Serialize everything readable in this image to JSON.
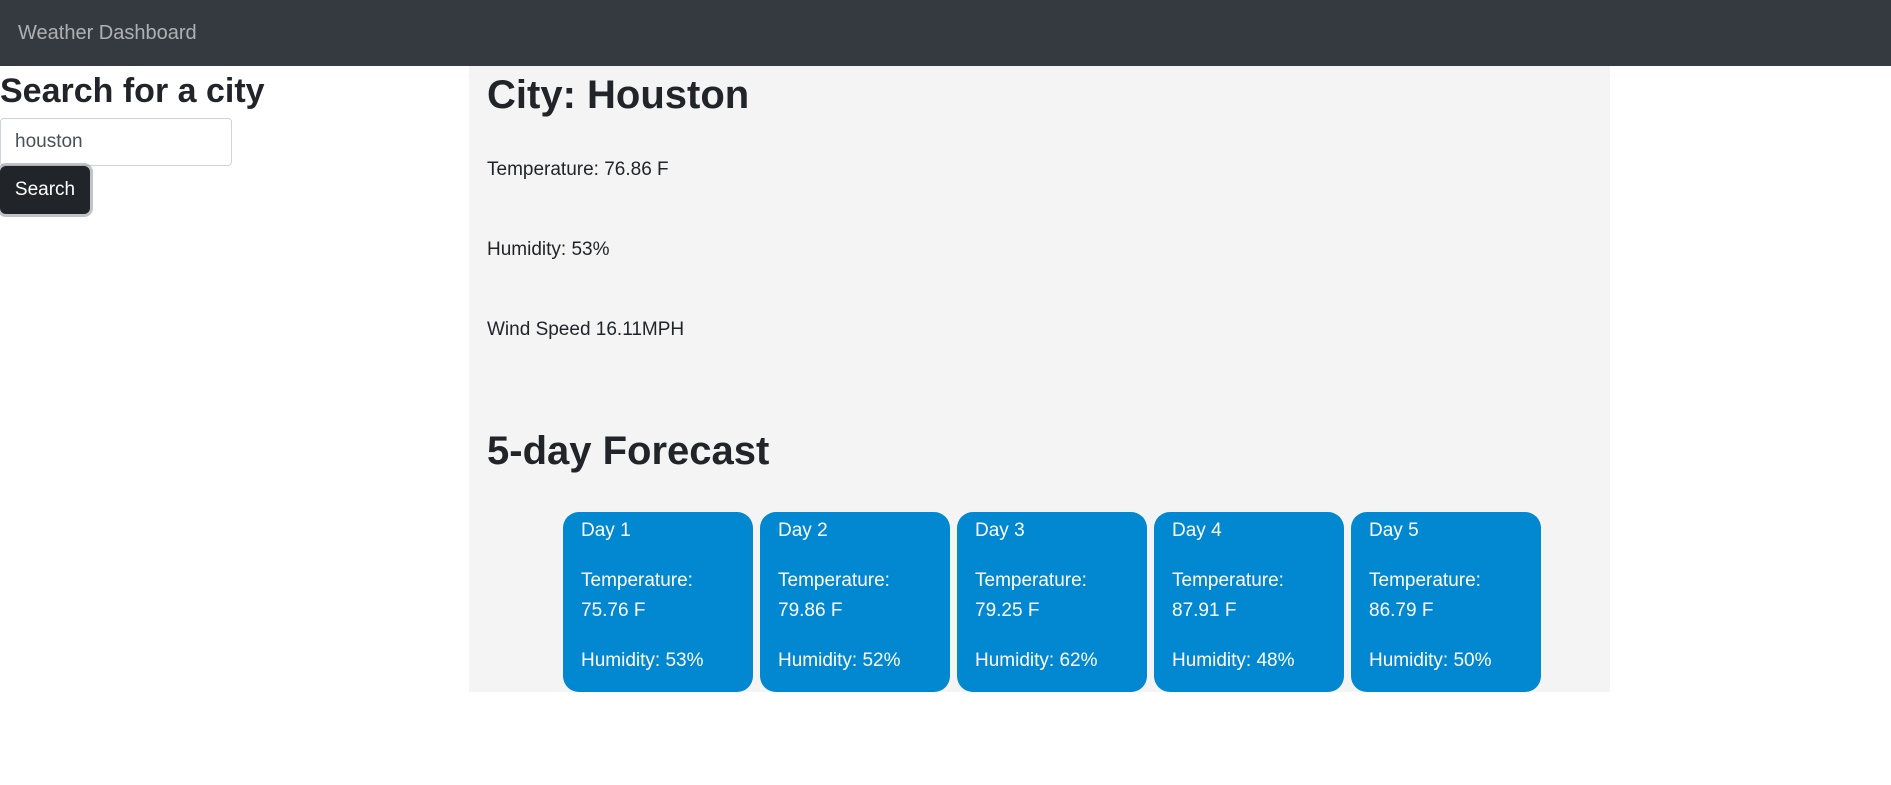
{
  "navbar": {
    "brand": "Weather Dashboard"
  },
  "search": {
    "title": "Search for a city",
    "input_value": "houston",
    "button_label": "Search"
  },
  "current": {
    "city": "City: Houston",
    "temperature": "Temperature: 76.86 F",
    "humidity": "Humidity: 53%",
    "wind": "Wind Speed 16.11MPH"
  },
  "forecast": {
    "title": "5-day Forecast",
    "card_color": "#0288d1",
    "days": [
      {
        "day": "Day 1",
        "temp_label": "Temperature:",
        "temp_value": "75.76 F",
        "humidity": "Humidity: 53%"
      },
      {
        "day": "Day 2",
        "temp_label": "Temperature:",
        "temp_value": "79.86 F",
        "humidity": "Humidity: 52%"
      },
      {
        "day": "Day 3",
        "temp_label": "Temperature:",
        "temp_value": "79.25 F",
        "humidity": "Humidity: 62%"
      },
      {
        "day": "Day 4",
        "temp_label": "Temperature:",
        "temp_value": "87.91 F",
        "humidity": "Humidity: 48%"
      },
      {
        "day": "Day 5",
        "temp_label": "Temperature:",
        "temp_value": "86.79 F",
        "humidity": "Humidity: 50%"
      }
    ]
  },
  "colors": {
    "navbar_bg": "#343a40",
    "main_bg": "#f4f4f4",
    "button_bg": "#212529"
  }
}
